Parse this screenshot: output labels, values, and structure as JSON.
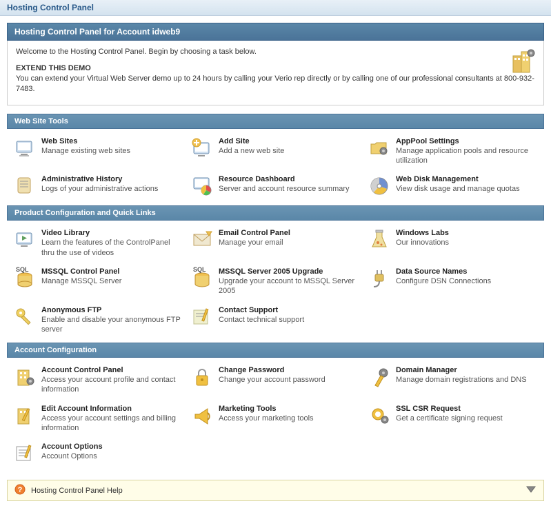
{
  "topHeader": "Hosting Control Panel",
  "mainHeader": "Hosting Control Panel for Account idweb9",
  "welcome": {
    "text": "Welcome to the Hosting Control Panel. Begin by choosing a task below.",
    "extendTitle": "EXTEND THIS DEMO",
    "extendBody": "You can extend your Virtual Web Server demo up to 24 hours by calling your Verio rep directly or by calling one of our professional consultants at 800-932-7483."
  },
  "sections": {
    "webSiteTools": {
      "title": "Web Site Tools",
      "items": [
        {
          "title": "Web Sites",
          "desc": "Manage existing web sites"
        },
        {
          "title": "Add Site",
          "desc": "Add a new web site"
        },
        {
          "title": "AppPool Settings",
          "desc": "Manage application pools and resource utilization"
        },
        {
          "title": "Administrative History",
          "desc": "Logs of your administrative actions"
        },
        {
          "title": "Resource Dashboard",
          "desc": "Server and account resource summary"
        },
        {
          "title": "Web Disk Management",
          "desc": "View disk usage and manage quotas"
        }
      ]
    },
    "productConfig": {
      "title": "Product Configuration and Quick Links",
      "items": [
        {
          "title": "Video Library",
          "desc": "Learn the features of the ControlPanel thru the use of videos"
        },
        {
          "title": "Email Control Panel",
          "desc": "Manage your email"
        },
        {
          "title": "Windows Labs",
          "desc": "Our innovations"
        },
        {
          "title": "MSSQL Control Panel",
          "desc": "Manage MSSQL Server"
        },
        {
          "title": "MSSQL Server 2005 Upgrade",
          "desc": "Upgrade your account to MSSQL Server 2005"
        },
        {
          "title": "Data Source Names",
          "desc": "Configure DSN Connections"
        },
        {
          "title": "Anonymous FTP",
          "desc": "Enable and disable your anonymous FTP server"
        },
        {
          "title": "Contact Support",
          "desc": "Contact technical support"
        }
      ]
    },
    "accountConfig": {
      "title": "Account Configuration",
      "items": [
        {
          "title": "Account Control Panel",
          "desc": "Access your account profile and contact information"
        },
        {
          "title": "Change Password",
          "desc": "Change your account password"
        },
        {
          "title": "Domain Manager",
          "desc": "Manage domain registrations and DNS"
        },
        {
          "title": "Edit Account Information",
          "desc": "Access your account settings and billing information"
        },
        {
          "title": "Marketing Tools",
          "desc": "Access your marketing tools"
        },
        {
          "title": "SSL CSR Request",
          "desc": "Get a certificate signing request"
        },
        {
          "title": "Account Options",
          "desc": "Account Options"
        }
      ]
    }
  },
  "helpBar": "Hosting Control Panel Help"
}
